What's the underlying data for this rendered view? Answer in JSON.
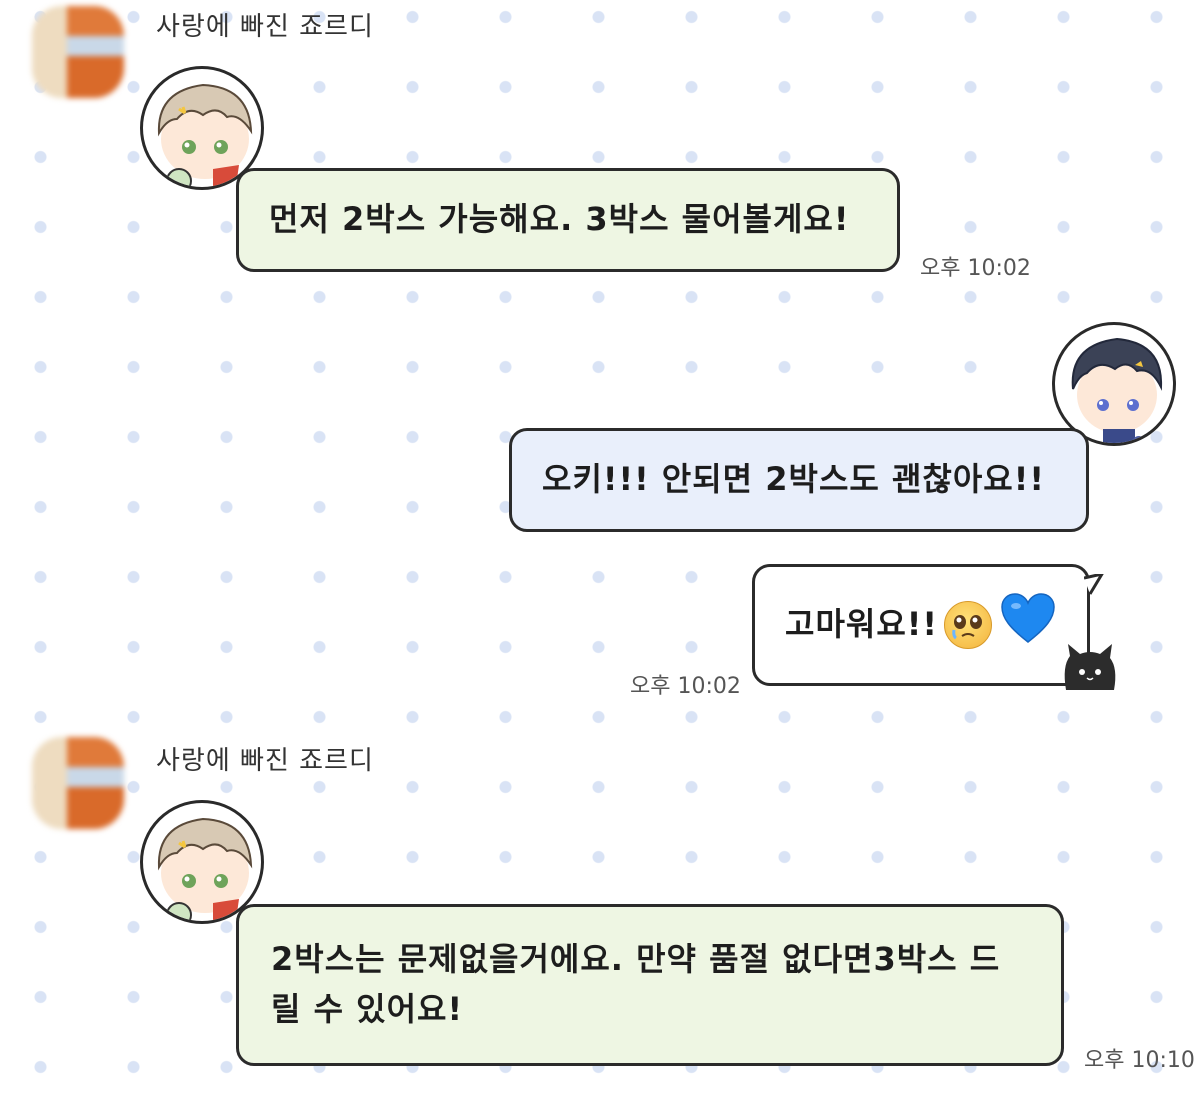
{
  "chat": {
    "messages": [
      {
        "id": "m1",
        "side": "left",
        "sender": "사랑에 빠진 죠르디",
        "text": "먼저 2박스 가능해요. 3박스 물어볼게요!",
        "time": "오후 10:02"
      },
      {
        "id": "m2",
        "side": "right",
        "text": "오키!!! 안되면 2박스도 괜찮아요!!"
      },
      {
        "id": "m3",
        "side": "right",
        "text": "고마워요!!",
        "emojis": [
          "pleading-face-icon",
          "blue-heart-icon"
        ],
        "time": "오후 10:02"
      },
      {
        "id": "m4",
        "side": "left",
        "sender": "사랑에 빠진 죠르디",
        "text": "2박스는 문제없을거에요. 만약 품절 없다면3박스 드릴 수 있어요!",
        "time": "오후 10:10"
      }
    ]
  },
  "colors": {
    "background": "#ffffff",
    "dot_pattern": "#d9e3f5",
    "bubble_green": "#eef6e3",
    "bubble_blue": "#e9effb",
    "bubble_border": "#2b2b2b",
    "time_text": "#555555"
  }
}
